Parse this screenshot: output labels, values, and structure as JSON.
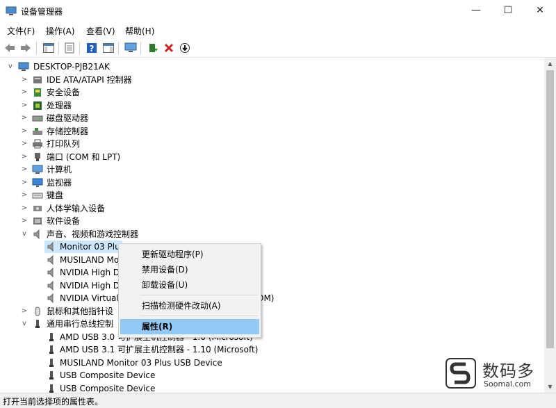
{
  "window": {
    "title": "设备管理器",
    "minimize": "—",
    "maximize": "☐",
    "close": "✕"
  },
  "menu": [
    "文件(F)",
    "操作(A)",
    "查看(V)",
    "帮助(H)"
  ],
  "tree": {
    "root": "DESKTOP-PJB21AK",
    "categories": [
      {
        "label": "IDE ATA/ATAPI 控制器",
        "icon": "ide-controller-icon"
      },
      {
        "label": "安全设备",
        "icon": "security-device-icon"
      },
      {
        "label": "处理器",
        "icon": "processor-icon"
      },
      {
        "label": "磁盘驱动器",
        "icon": "disk-drive-icon"
      },
      {
        "label": "存储控制器",
        "icon": "storage-controller-icon"
      },
      {
        "label": "打印队列",
        "icon": "printer-icon"
      },
      {
        "label": "端口 (COM 和 LPT)",
        "icon": "port-icon"
      },
      {
        "label": "计算机",
        "icon": "computer-icon"
      },
      {
        "label": "监视器",
        "icon": "monitor-icon"
      },
      {
        "label": "键盘",
        "icon": "keyboard-icon"
      },
      {
        "label": "人体学输入设备",
        "icon": "hid-icon"
      },
      {
        "label": "软件设备",
        "icon": "software-device-icon"
      }
    ],
    "audio_category": "声音、视频和游戏控制器",
    "audio_devices": [
      "Monitor 03 Plu",
      "MUSILAND Mo",
      "NVIDIA High D",
      "NVIDIA High D",
      "NVIDIA Virtual",
      "OM)"
    ],
    "mouse_category": "鼠标和其他指针设",
    "usb_category": "通用串行总线控制",
    "usb_devices": [
      "AMD USB 3.0 可扩展主机控制器 - 1.0 (Microsoft)",
      "AMD USB 3.1 可扩展主机控制器 - 1.10 (Microsoft)",
      "MUSILAND Monitor 03 Plus USB Device",
      "USB Composite Device",
      "USB Composite Device"
    ]
  },
  "context_menu": {
    "items": [
      "更新驱动程序(P)",
      "禁用设备(D)",
      "卸载设备(U)",
      "扫描检测硬件改动(A)",
      "属性(R)"
    ]
  },
  "status": "打开当前选择项的属性表。",
  "watermark": {
    "cn": "数码多",
    "en": "Soomal.com"
  },
  "colors": {
    "selection": "#cce8ff",
    "menu_highlight": "#91c9f7",
    "delete_red": "#d21f1f"
  }
}
